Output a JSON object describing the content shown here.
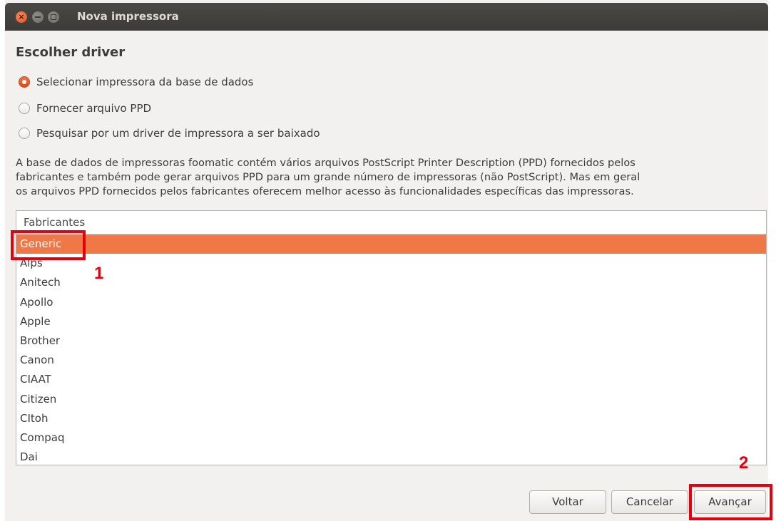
{
  "window": {
    "title": "Nova impressora"
  },
  "page": {
    "heading": "Escolher driver"
  },
  "options": [
    {
      "label": "Selecionar impressora da base de dados",
      "checked": true
    },
    {
      "label": "Fornecer arquivo PPD",
      "checked": false
    },
    {
      "label": "Pesquisar por um driver de impressora a ser baixado",
      "checked": false
    }
  ],
  "description": {
    "line1": "A base de dados de impressoras foomatic contém vários arquivos PostScript Printer Description (PPD) fornecidos pelos",
    "line2": "fabricantes e também pode gerar arquivos PPD para um grande número de impressoras (não PostScript). Mas em geral",
    "line3": "os arquivos PPD fornecidos pelos fabricantes oferecem melhor acesso às funcionalidades específicas das impressoras."
  },
  "manufacturers": {
    "header": "Fabricantes",
    "selected": "Generic",
    "items": [
      "Generic",
      "Alps",
      "Anitech",
      "Apollo",
      "Apple",
      "Brother",
      "Canon",
      "CIAAT",
      "Citizen",
      "CItoh",
      "Compaq",
      "Dai"
    ]
  },
  "buttons": {
    "back": "Voltar",
    "cancel": "Cancelar",
    "forward": "Avançar"
  },
  "annotations": {
    "step1": "1",
    "step2": "2",
    "color": "#e3000f"
  },
  "colors": {
    "accent": "#f07746",
    "titlebar": "#3c3b37",
    "close_button": "#e3501f"
  }
}
